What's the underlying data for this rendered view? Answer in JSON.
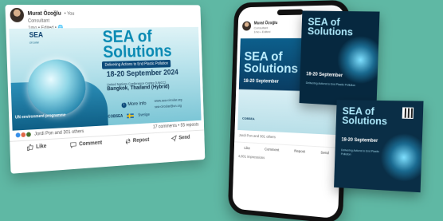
{
  "card": {
    "author": "Murat Özoğlu",
    "connection": "• You",
    "role": "Consultant",
    "meta": "1mo • Edited • 🌐",
    "banner": {
      "org_logo": "SEA",
      "org_logo_sub": "circular",
      "title_line1": "SEA of",
      "title_line2": "Solutions",
      "subtitle": "Delivering Actions to End Plastic Pollution",
      "dates": "18-20 September 2024",
      "venue_line1": "United Nations Conference Centre (UNCC)",
      "venue_city": "Bangkok, Thailand (Hybrid)",
      "more_info": "More info",
      "link1": "www.sea-circular.org",
      "link2": "sea-circular@un.org",
      "sponsor1": "COBSEA",
      "sponsor2": "Sverige",
      "un_logo": "UN environment programme"
    },
    "reactions_text": "Jordi Pon and 301 others",
    "stats_text": "17 comments • 55 reposts",
    "actions": {
      "like": "Like",
      "comment": "Comment",
      "repost": "Repost",
      "send": "Send"
    }
  },
  "phone": {
    "author": "Murat Özoğlu",
    "sub1": "Consultant",
    "sub2": "1mo • Edited",
    "title_line1": "SEA of",
    "title_line2": "Solutions",
    "dates": "18-20 September",
    "footer": "COBSEA",
    "reactions": "Jordi Pon and 301 others",
    "actions": [
      "Like",
      "Comment",
      "Repost",
      "Send"
    ],
    "impressions": "4,801 impressions"
  },
  "slides": [
    {
      "title_line1": "SEA of",
      "title_line2": "Solutions",
      "dates": "18-20 September",
      "text": "Delivering Actions to End Plastic Pollution"
    },
    {
      "title_line1": "SEA of",
      "title_line2": "Solutions",
      "dates": "18-20 September",
      "text": "Delivering Actions to End Plastic Pollution"
    }
  ]
}
